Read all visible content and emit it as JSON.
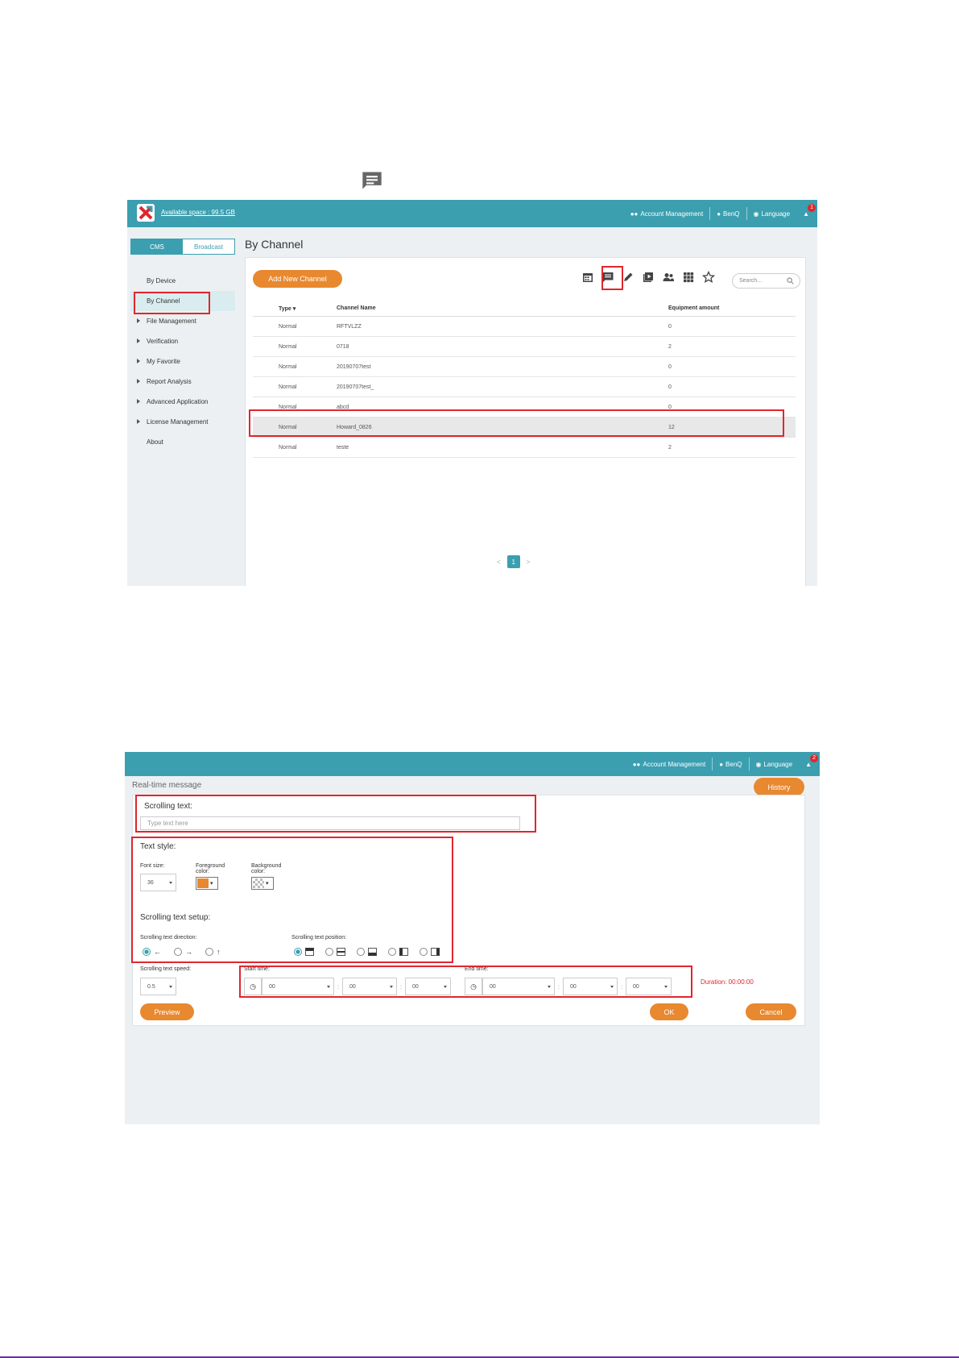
{
  "shot1": {
    "available_space": "Available space : 99.5 GB",
    "topbar": {
      "account": "Account Management",
      "user": "BenQ",
      "language": "Language",
      "badge": "1"
    },
    "tabs": {
      "cms": "CMS",
      "broadcast": "Broadcast"
    },
    "nav": [
      {
        "label": "By Device",
        "caret": false
      },
      {
        "label": "By Channel",
        "caret": false,
        "active": true
      },
      {
        "label": "File Management",
        "caret": true
      },
      {
        "label": "Verification",
        "caret": true
      },
      {
        "label": "My Favorite",
        "caret": true
      },
      {
        "label": "Report Analysis",
        "caret": true
      },
      {
        "label": "Advanced Application",
        "caret": true
      },
      {
        "label": "License Management",
        "caret": true
      },
      {
        "label": "About",
        "caret": false
      }
    ],
    "page_title": "By Channel",
    "add_button": "Add New Channel",
    "search_placeholder": "Search...",
    "table": {
      "headers": {
        "type": "Type",
        "name": "Channel Name",
        "equipment": "Equipment amount"
      },
      "rows": [
        {
          "type": "Normal",
          "name": "RFTVLZZ",
          "equipment": "0"
        },
        {
          "type": "Normal",
          "name": "0718",
          "equipment": "2"
        },
        {
          "type": "Normal",
          "name": "20190707test",
          "equipment": "0"
        },
        {
          "type": "Normal",
          "name": "20190707test_",
          "equipment": "0"
        },
        {
          "type": "Normal",
          "name": "abcd",
          "equipment": "0"
        },
        {
          "type": "Normal",
          "name": "Howard_0826",
          "equipment": "12"
        },
        {
          "type": "Normal",
          "name": "teste",
          "equipment": "2"
        }
      ]
    },
    "pager": {
      "prev": "<",
      "page": "1",
      "next": ">"
    }
  },
  "shot2": {
    "topbar": {
      "account": "Account Management",
      "user": "BenQ",
      "language": "Language",
      "badge": "2"
    },
    "title": "Real-time message",
    "history": "History",
    "scrolling_text_label": "Scrolling text:",
    "text_placeholder": "Type text here",
    "text_style_label": "Text style:",
    "font_size_label": "Font size:",
    "font_size_value": "36",
    "foreground_label_1": "Foreground",
    "foreground_label_2": "color:",
    "background_label_1": "Background",
    "background_label_2": "color:",
    "setup_label": "Scrolling text setup:",
    "direction_label": "Scrolling text direction:",
    "position_label": "Scrolling text position:",
    "speed_label": "Scrolling text speed:",
    "speed_value": "0.5",
    "start_label": "Start time:",
    "end_label": "End time:",
    "time_value": "00",
    "duration": "Duration: 00:00:00",
    "preview": "Preview",
    "ok": "OK",
    "cancel": "Cancel"
  },
  "colors": {
    "teal": "#3b9fb0",
    "orange": "#e8882f",
    "red": "#e0262e",
    "foreground_swatch": "#e8882f"
  }
}
